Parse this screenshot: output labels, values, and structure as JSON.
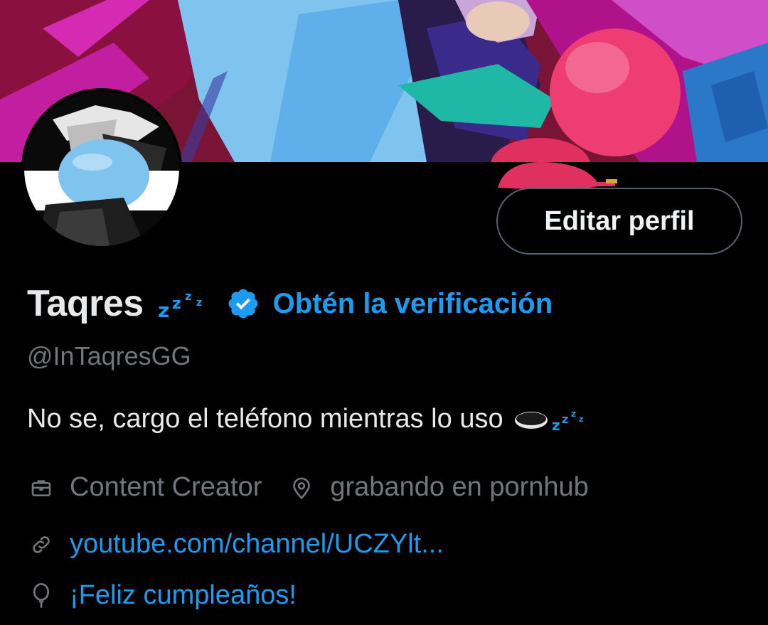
{
  "profile": {
    "display_name": "Taqres",
    "handle": "@InTaqresGG",
    "get_verified_label": "Obtén la verificación",
    "edit_profile_label": "Editar perfil",
    "bio_text": "No se, cargo el teléfono mientras lo uso",
    "profession": "Content Creator",
    "location": "grabando en pornhub",
    "website": "youtube.com/channel/UCZYlt...",
    "birthday": "¡Feliz cumpleaños!"
  },
  "icons": {
    "sleep": "zzz-icon",
    "verified": "verified-badge-icon",
    "hole": "hole-emoji-icon",
    "professional": "briefcase-icon",
    "location": "location-pin-icon",
    "website": "link-icon",
    "birthday": "balloon-icon"
  },
  "colors": {
    "background": "#000000",
    "accent": "#1d9bf0",
    "secondary_text": "#71767b",
    "primary_text": "#e7e9ea"
  }
}
